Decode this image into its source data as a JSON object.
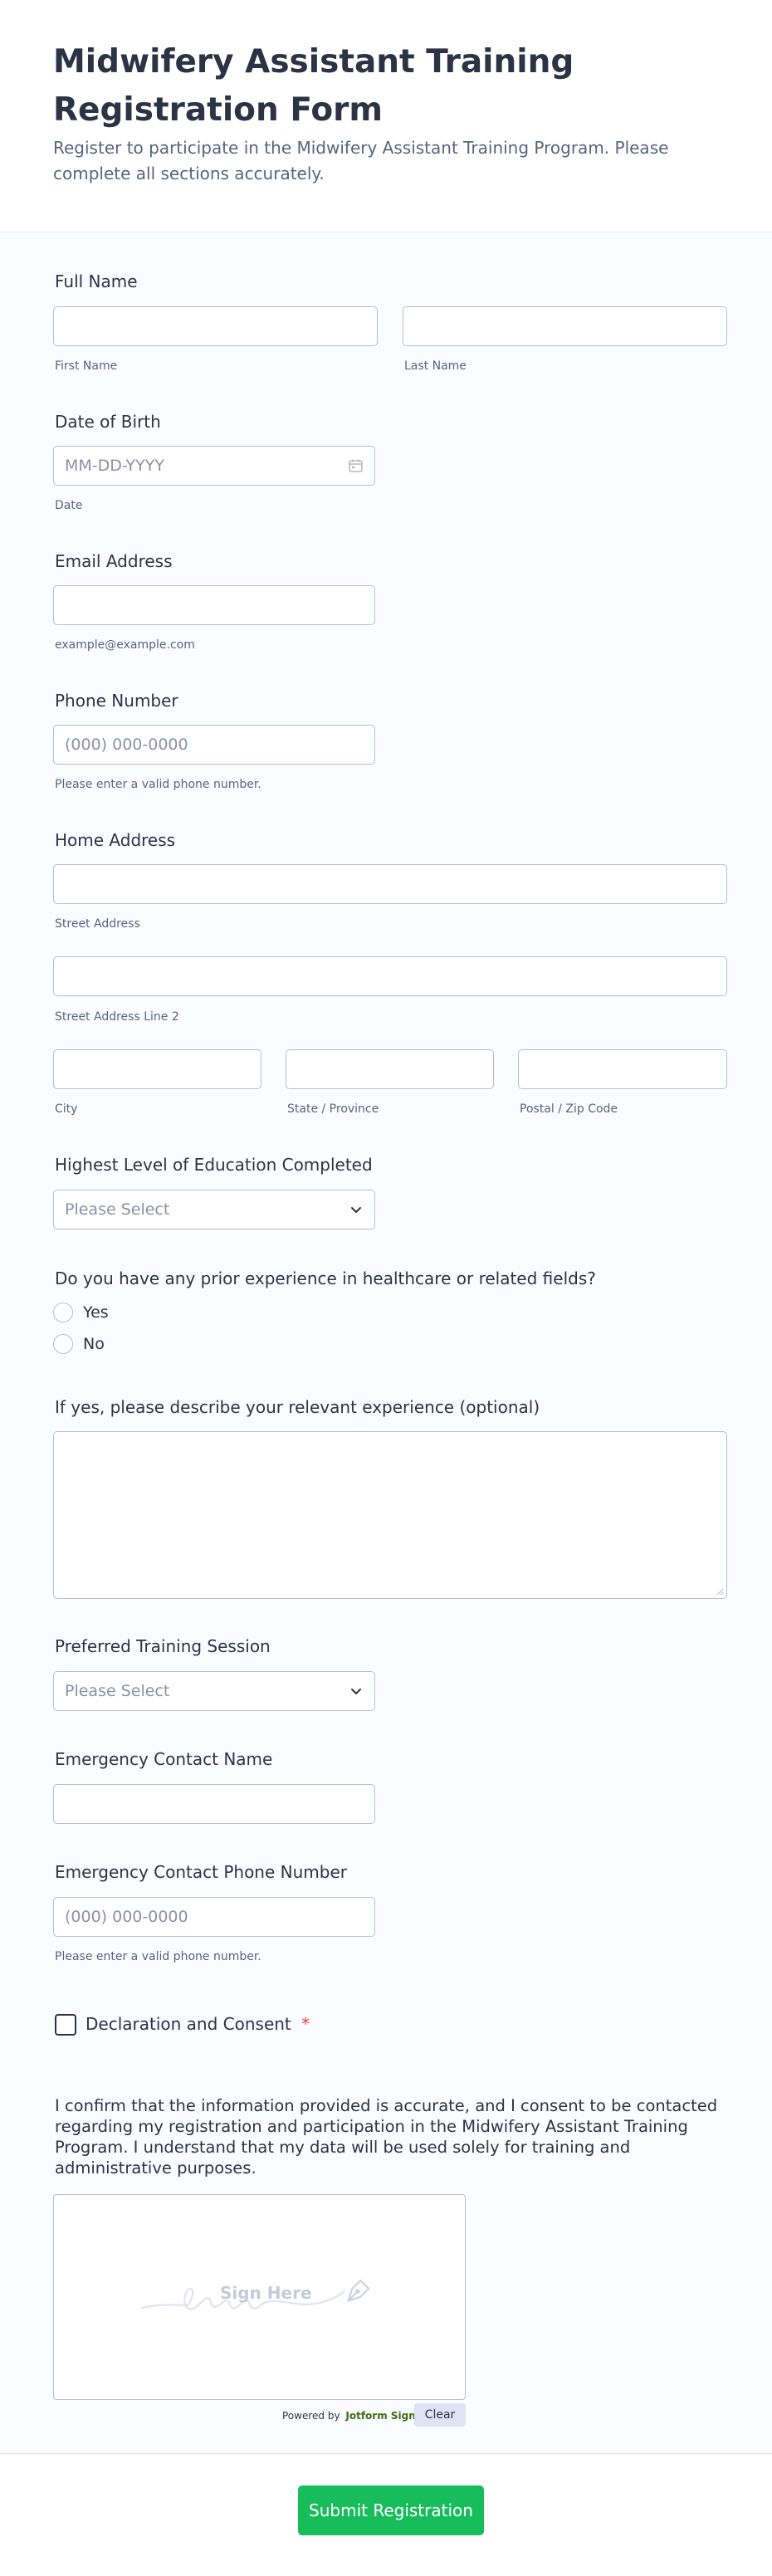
{
  "header": {
    "title": "Midwifery Assistant Training Registration Form",
    "subtitle": "Register to participate in the Midwifery Assistant Training Program. Please complete all sections accurately."
  },
  "full_name": {
    "label": "Full Name",
    "first_sublabel": "First Name",
    "last_sublabel": "Last Name"
  },
  "dob": {
    "label": "Date of Birth",
    "placeholder": "MM-DD-YYYY",
    "sublabel": "Date",
    "icon": "calendar-icon"
  },
  "email": {
    "label": "Email Address",
    "sublabel": "example@example.com"
  },
  "phone": {
    "label": "Phone Number",
    "placeholder": "(000) 000-0000",
    "sublabel": "Please enter a valid phone number."
  },
  "address": {
    "label": "Home Address",
    "street_sublabel": "Street Address",
    "street2_sublabel": "Street Address Line 2",
    "city_sublabel": "City",
    "state_sublabel": "State / Province",
    "postal_sublabel": "Postal / Zip Code"
  },
  "education": {
    "label": "Highest Level of Education Completed",
    "selected": "Please Select"
  },
  "experience": {
    "label": "Do you have any prior experience in healthcare or related fields?",
    "options": [
      "Yes",
      "No"
    ]
  },
  "experience_desc": {
    "label": "If yes, please describe your relevant experience (optional)"
  },
  "session": {
    "label": "Preferred Training Session",
    "selected": "Please Select"
  },
  "emergency_name": {
    "label": "Emergency Contact Name"
  },
  "emergency_phone": {
    "label": "Emergency Contact Phone Number",
    "placeholder": "(000) 000-0000",
    "sublabel": "Please enter a valid phone number."
  },
  "consent": {
    "label": "Declaration and Consent",
    "required_mark": "*",
    "text": "I confirm that the information provided is accurate, and I consent to be contacted regarding my registration and participation in the Midwifery Assistant Training Program. I understand that my data will be used solely for training and administrative purposes."
  },
  "signature": {
    "placeholder": "Sign Here",
    "powered_by": "Powered by",
    "brand": "Jotform Sign",
    "clear_label": "Clear"
  },
  "submit": {
    "label": "Submit Registration"
  },
  "colors": {
    "accent": "#18bd5b",
    "text": "#2c3345",
    "sublabel": "#57647e",
    "border": "#b8bdc9",
    "required": "#f23a3c"
  }
}
